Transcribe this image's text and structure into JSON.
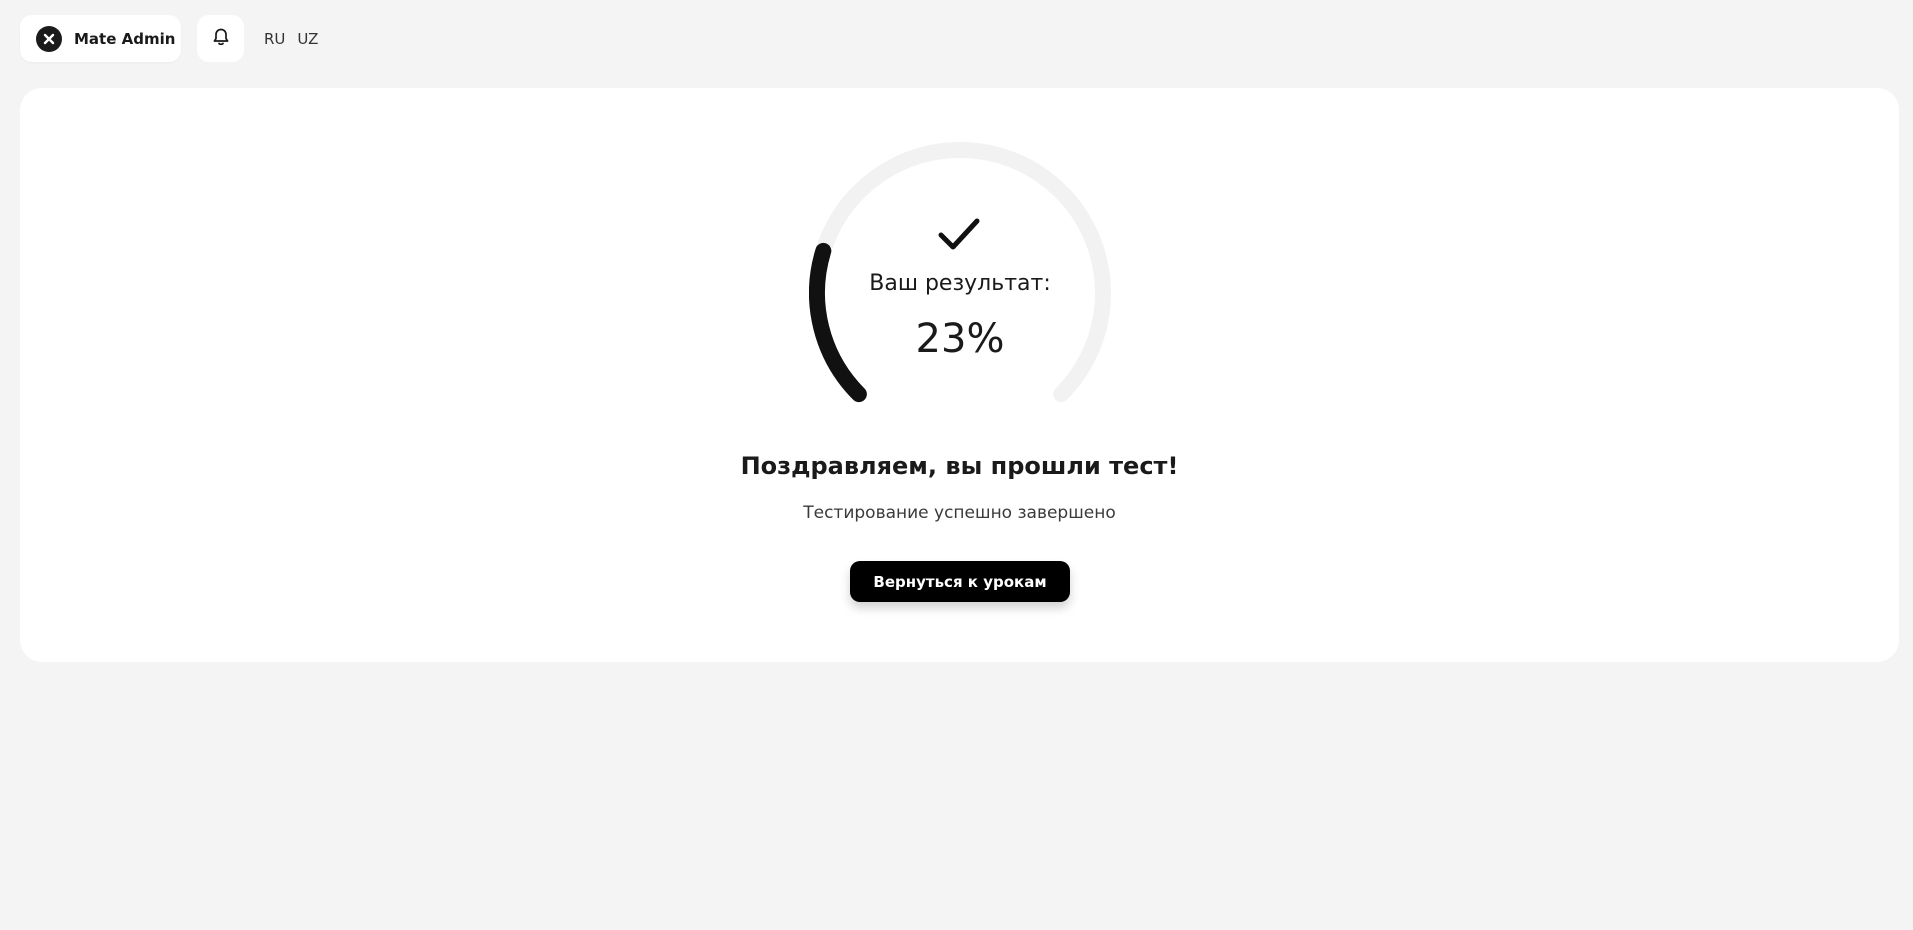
{
  "header": {
    "user_name": "Mate Admin",
    "languages": [
      "RU",
      "UZ"
    ]
  },
  "result": {
    "label": "Ваш результат:",
    "percent": 23,
    "value_text": "23%",
    "gauge_track_color": "#f2f2f2",
    "gauge_fill_color": "#111111"
  },
  "message": {
    "title": "Поздравляем, вы прошли тест!",
    "subtitle": "Тестирование успешно завершено"
  },
  "actions": {
    "back_label": "Вернуться к урокам"
  },
  "icons": {
    "avatar": "avatar-icon",
    "notifications": "bell-icon",
    "success": "checkmark-icon"
  }
}
